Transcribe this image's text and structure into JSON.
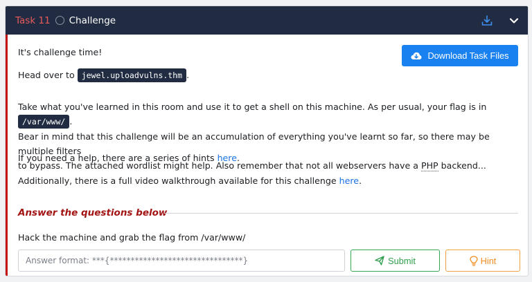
{
  "header": {
    "task_number": "Task 11",
    "task_title": "Challenge"
  },
  "body": {
    "intro": "It's challenge time!",
    "head_over_prefix": "Head over to",
    "host": "jewel.uploadvulns.thm",
    "head_over_suffix": ".",
    "para_line1_prefix": "Take what you've learned in this room and use it to get a shell on this machine. As per usual, your flag is in",
    "flag_path": "/var/www/",
    "para_line1_suffix": ".",
    "para_line2": "Bear in mind that this challenge will be an accumulation of everything you've learnt so far, so there may be multiple filters",
    "para_line3_prefix": "to bypass. The attached wordlist might help. Also remember that not all webservers have a",
    "php": "PHP",
    "para_line3_suffix": "backend...",
    "hints_prefix": "If you need a help, there are a series of hints",
    "hints_link": "here",
    "hints_suffix": ".",
    "video_prefix": "Additionally, there is a full video walkthrough available for this challenge",
    "video_link": "here",
    "video_suffix": "."
  },
  "download_button": {
    "label": "Download Task Files",
    "icon": "cloud-download-icon"
  },
  "answers": {
    "heading": "Answer the questions below",
    "question": "Hack the machine and grab the flag from /var/www/",
    "placeholder": "Answer format: ***{********************************}",
    "submit_label": "Submit",
    "hint_label": "Hint"
  },
  "colors": {
    "header_bg": "#212c42",
    "task_number": "#e8595c",
    "accent_red": "#c11111",
    "primary_blue": "#1a82f0",
    "submit_green": "#36a852",
    "hint_orange": "#f0a045"
  }
}
